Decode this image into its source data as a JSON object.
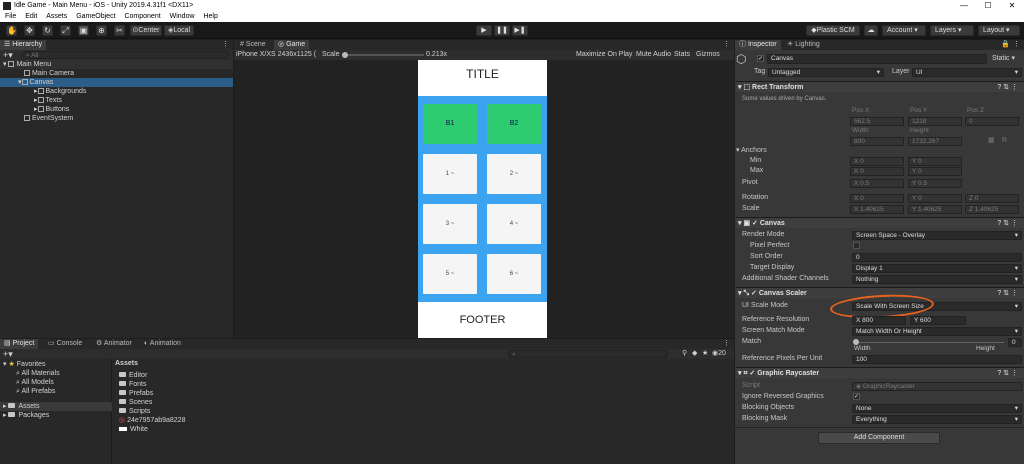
{
  "window": {
    "title": "Idle Game - Main Menu - iOS - Unity 2019.4.31f1 <DX11>"
  },
  "menu": [
    "File",
    "Edit",
    "Assets",
    "GameObject",
    "Component",
    "Window",
    "Help"
  ],
  "toolbar": {
    "center": "Center",
    "local": "Local",
    "plastic": "Plastic SCM",
    "account": "Account",
    "layers": "Layers",
    "layout": "Layout"
  },
  "hierarchy": {
    "tab": "Hierarchy",
    "search_placeholder": "All",
    "scene": "Main Menu",
    "items": [
      "Main Camera",
      "Canvas",
      "Backgrounds",
      "Texts",
      "Buttons",
      "EventSystem"
    ]
  },
  "scenebar": {
    "tabs": [
      "Scene",
      "Game"
    ],
    "resolution": "iPhone X/XS 2436x1125 ( ",
    "scale_label": "Scale",
    "scale_value": "0.213x",
    "options": [
      "Maximize On Play",
      "Mute Audio",
      "Stats",
      "Gizmos"
    ]
  },
  "game": {
    "title": "TITLE",
    "footer": "FOOTER",
    "cards": [
      "B1",
      "B2",
      "1 ~",
      "2 ~",
      "3 ~",
      "4 ~",
      "5 ~",
      "6 ~"
    ]
  },
  "project": {
    "tabs": [
      "Project",
      "Console",
      "Animator",
      "Animation"
    ],
    "favorites": "Favorites",
    "fav_items": [
      "All Materials",
      "All Models",
      "All Prefabs"
    ],
    "roots": [
      "Assets",
      "Packages"
    ],
    "assets_header": "Assets",
    "assets": [
      "Editor",
      "Fonts",
      "Prefabs",
      "Scenes",
      "Scripts",
      "24e7957ab9a8228",
      "White"
    ],
    "count": "20"
  },
  "inspector": {
    "tabs": [
      "Inspector",
      "Lighting"
    ],
    "object_name": "Canvas",
    "static_label": "Static",
    "tag_label": "Tag",
    "tag_value": "Untagged",
    "layer_label": "Layer",
    "layer_value": "UI",
    "rect": {
      "title": "Rect Transform",
      "note": "Some values driven by Canvas.",
      "posx_label": "Pos X",
      "posy_label": "Pos Y",
      "posz_label": "Pos Z",
      "posx": "562.5",
      "posy": "1218",
      "posz": "0",
      "w_label": "Width",
      "h_label": "Height",
      "width": "800",
      "height": "1732.267",
      "anchors": "Anchors",
      "min": "Min",
      "max": "Max",
      "min_x": "X 0",
      "min_y": "Y 0",
      "max_x": "X 0",
      "max_y": "Y 0",
      "pivot": "Pivot",
      "pivot_x": "X 0.5",
      "pivot_y": "Y 0.5",
      "rotation": "Rotation",
      "rot_x": "X 0",
      "rot_y": "Y 0",
      "rot_z": "Z 0",
      "scale": "Scale",
      "scale_x": "X 1.40625",
      "scale_y": "Y 1.40625",
      "scale_z": "Z 1.40625"
    },
    "canvas": {
      "title": "Canvas",
      "render_mode_label": "Render Mode",
      "render_mode": "Screen Space - Overlay",
      "pixel_perfect": "Pixel Perfect",
      "sort_order_label": "Sort Order",
      "sort_order": "0",
      "target_display_label": "Target Display",
      "target_display": "Display 1",
      "shader_label": "Additional Shader Channels",
      "shader": "Nothing"
    },
    "scaler": {
      "title": "Canvas Scaler",
      "mode_label": "UI Scale Mode",
      "mode": "Scale With Screen Size",
      "res_label": "Reference Resolution",
      "res_x": "X  800",
      "res_y": "Y  600",
      "match_mode_label": "Screen Match Mode",
      "match_mode": "Match Width Or Height",
      "match_label": "Match",
      "match_value": "0",
      "width_label": "Width",
      "height_label": "Height",
      "ppu_label": "Reference Pixels Per Unit",
      "ppu": "100"
    },
    "raycaster": {
      "title": "Graphic Raycaster",
      "script_label": "Script",
      "script": "GraphicRaycaster",
      "ignore_label": "Ignore Reversed Graphics",
      "blocking_label": "Blocking Objects",
      "blocking": "None",
      "mask_label": "Blocking Mask",
      "mask": "Everything"
    },
    "add_component": "Add Component"
  },
  "colors": {
    "selection": "#2c5d87",
    "highlight_circle": "#e8621f",
    "game_blue": "#3ba3f0",
    "card_green": "#2ecc71"
  }
}
